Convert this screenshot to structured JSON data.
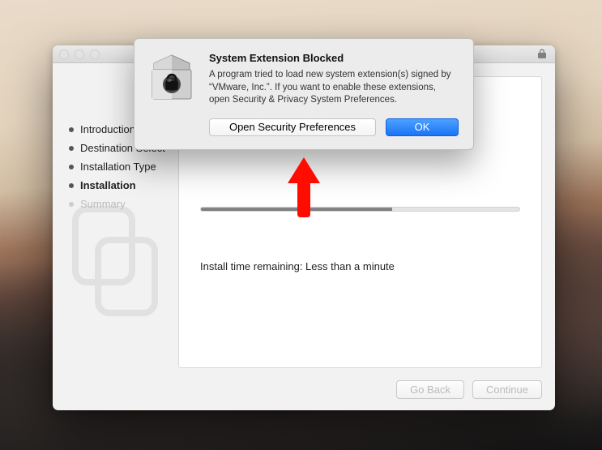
{
  "sidebar": {
    "items": [
      {
        "label": "Introduction",
        "state": "done"
      },
      {
        "label": "Destination Select",
        "state": "done"
      },
      {
        "label": "Installation Type",
        "state": "done"
      },
      {
        "label": "Installation",
        "state": "active"
      },
      {
        "label": "Summary",
        "state": "pending"
      }
    ]
  },
  "main": {
    "install_text": "Install time remaining: Less than a minute",
    "progress_pct": 60
  },
  "footer": {
    "back_label": "Go Back",
    "continue_label": "Continue"
  },
  "dialog": {
    "title": "System Extension Blocked",
    "body": "A program tried to load new system extension(s) signed by “VMware, Inc.”.  If you want to enable these extensions, open Security & Privacy System Preferences.",
    "open_label": "Open Security Preferences",
    "ok_label": "OK"
  },
  "colors": {
    "primary_button": "#1c73f5",
    "arrow": "#ff0c00"
  }
}
